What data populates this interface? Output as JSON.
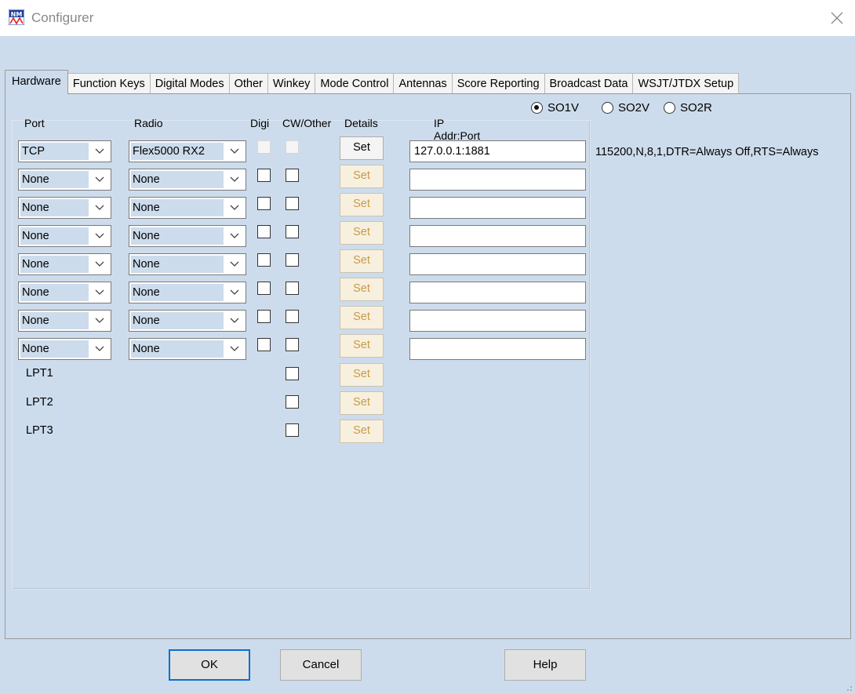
{
  "window": {
    "title": "Configurer"
  },
  "tabs": [
    {
      "label": "Hardware",
      "active": true
    },
    {
      "label": "Function Keys"
    },
    {
      "label": "Digital Modes"
    },
    {
      "label": "Other"
    },
    {
      "label": "Winkey"
    },
    {
      "label": "Mode Control"
    },
    {
      "label": "Antennas"
    },
    {
      "label": "Score Reporting"
    },
    {
      "label": "Broadcast Data"
    },
    {
      "label": "WSJT/JTDX Setup"
    }
  ],
  "headers": {
    "port": "Port",
    "radio": "Radio",
    "digi": "Digi",
    "cw_other": "CW/Other",
    "details": "Details",
    "ip_addr": "IP Addr:Port"
  },
  "operation_mode": {
    "options": [
      "SO1V",
      "SO2V",
      "SO2R"
    ],
    "selected": "SO1V"
  },
  "ports": [
    {
      "port": "TCP",
      "radio": "Flex5000 RX2",
      "digi": false,
      "cw": false,
      "set": "Set",
      "ip": "127.0.0.1:1881",
      "disabled": true
    },
    {
      "port": "None",
      "radio": "None",
      "digi": false,
      "cw": false,
      "set": "Set",
      "ip": ""
    },
    {
      "port": "None",
      "radio": "None",
      "digi": false,
      "cw": false,
      "set": "Set",
      "ip": ""
    },
    {
      "port": "None",
      "radio": "None",
      "digi": false,
      "cw": false,
      "set": "Set",
      "ip": ""
    },
    {
      "port": "None",
      "radio": "None",
      "digi": false,
      "cw": false,
      "set": "Set",
      "ip": ""
    },
    {
      "port": "None",
      "radio": "None",
      "digi": false,
      "cw": false,
      "set": "Set",
      "ip": ""
    },
    {
      "port": "None",
      "radio": "None",
      "digi": false,
      "cw": false,
      "set": "Set",
      "ip": ""
    },
    {
      "port": "None",
      "radio": "None",
      "digi": false,
      "cw": false,
      "set": "Set",
      "ip": ""
    }
  ],
  "lpt_ports": [
    {
      "label": "LPT1",
      "set": "Set"
    },
    {
      "label": "LPT2",
      "set": "Set"
    },
    {
      "label": "LPT3",
      "set": "Set"
    }
  ],
  "serial_settings": "115200,N,8,1,DTR=Always Off,RTS=Always",
  "buttons": {
    "ok": "OK",
    "cancel": "Cancel",
    "help": "Help"
  },
  "colors": {
    "background": "#cddcec",
    "default_button_border": "#0a6fd1",
    "disabled_set_text": "#c89a48"
  }
}
